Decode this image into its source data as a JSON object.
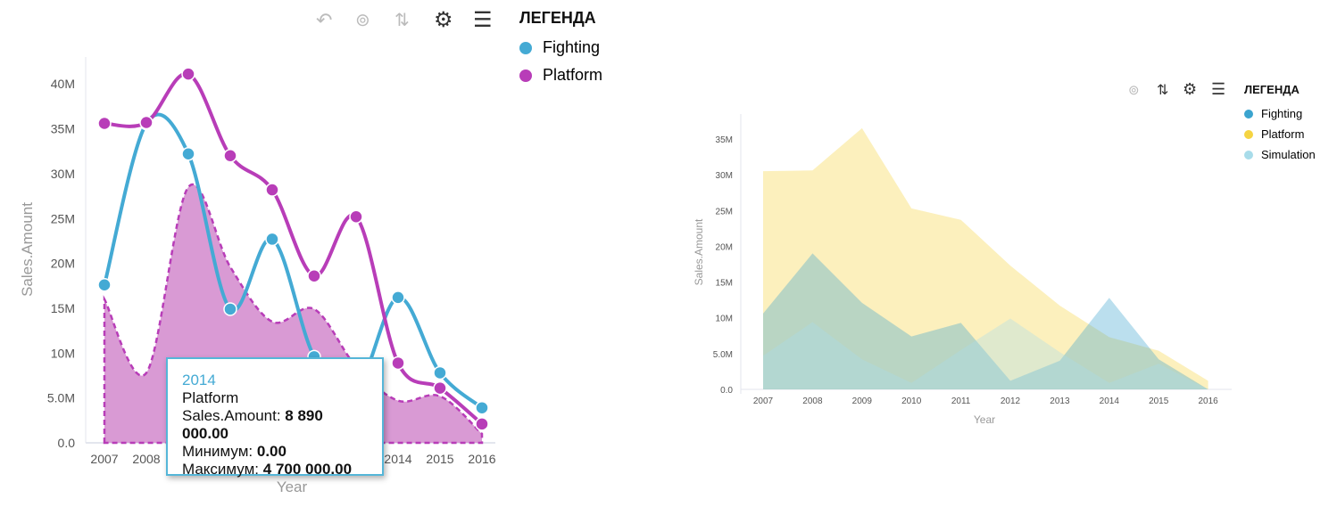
{
  "toolbar_left": {
    "icons": [
      "undo-icon",
      "zoom-icon",
      "swap-axes-icon",
      "gear-icon",
      "legend-list-icon"
    ]
  },
  "toolbar_right": {
    "icons": [
      "zoom-icon",
      "swap-axes-icon",
      "gear-icon",
      "legend-list-icon"
    ]
  },
  "chart_data": [
    {
      "type": "line",
      "subtype": "spline with range area",
      "xlabel": "Year",
      "ylabel": "Sales.Amount",
      "ylim": [
        0,
        42
      ],
      "categories": [
        "2007",
        "2008",
        "2009",
        "2010",
        "2011",
        "2012",
        "2013",
        "2014",
        "2015",
        "2016"
      ],
      "yticks": [
        "0.0",
        "5.0M",
        "10M",
        "15M",
        "20M",
        "25M",
        "30M",
        "35M",
        "40M"
      ],
      "legend": {
        "title": "ЛЕГЕНДА",
        "placement": "right"
      },
      "series": [
        {
          "name": "Fighting",
          "color": "#44aad4",
          "values": [
            17.6,
            35.6,
            32.2,
            14.9,
            22.7,
            9.6,
            6.0,
            16.2,
            7.8,
            3.9
          ]
        },
        {
          "name": "Platform",
          "color": "#b83db8",
          "values": [
            35.6,
            35.7,
            41.1,
            32.0,
            28.2,
            18.6,
            25.2,
            8.89,
            6.1,
            2.1
          ],
          "range": {
            "min": [
              0,
              0,
              0,
              0,
              0,
              0,
              0,
              0,
              0,
              0
            ],
            "max": [
              16.0,
              7.8,
              28.5,
              19.6,
              13.5,
              14.9,
              8.5,
              4.7,
              5.2,
              1.0
            ],
            "color": "#d99ad4"
          }
        }
      ],
      "tooltip": {
        "title": "2014",
        "series": "Platform",
        "rows": [
          {
            "label": "Sales.Amount: ",
            "value": "8 890 000.00"
          },
          {
            "label": "Минимум: ",
            "value": "0.00"
          },
          {
            "label": "Максимум: ",
            "value": "4 700 000.00"
          }
        ]
      }
    },
    {
      "type": "area",
      "xlabel": "Year",
      "ylabel": "Sales.Amount",
      "ylim": [
        0,
        37
      ],
      "categories": [
        "2007",
        "2008",
        "2009",
        "2010",
        "2011",
        "2012",
        "2013",
        "2014",
        "2015",
        "2016"
      ],
      "yticks": [
        "0.0",
        "5.0M",
        "10M",
        "15M",
        "20M",
        "25M",
        "30M",
        "35M"
      ],
      "legend": {
        "title": "ЛЕГЕНДА",
        "placement": "right"
      },
      "series": [
        {
          "name": "Fighting",
          "color": "#3ba4cf",
          "values": [
            10.6,
            19.0,
            12.1,
            7.4,
            9.3,
            1.2,
            4.0,
            12.8,
            4.2,
            0
          ]
        },
        {
          "name": "Platform",
          "color": "#f5d442",
          "values": [
            30.5,
            30.6,
            36.5,
            25.3,
            23.7,
            17.3,
            11.7,
            7.3,
            5.4,
            1.2
          ]
        },
        {
          "name": "Simulation",
          "color": "#a8dcea",
          "values": [
            4.7,
            9.4,
            4.2,
            0.9,
            5.5,
            9.9,
            5.2,
            0.9,
            3.6,
            0
          ]
        }
      ]
    }
  ]
}
